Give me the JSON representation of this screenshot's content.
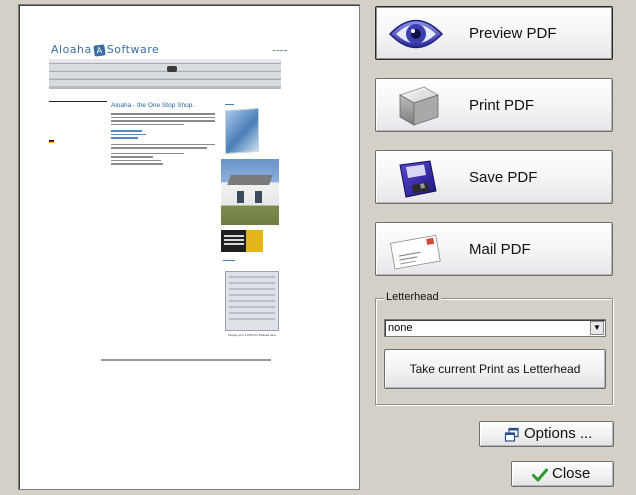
{
  "preview": {
    "logo_text_left": "Aloaha",
    "logo_mark": "A",
    "logo_text_right": "Software",
    "headline": "Aloaha - the One Stop Shop.",
    "screenshot_caption": "Output your 2 PNG for Preload here"
  },
  "buttons": {
    "preview": {
      "label": "Preview PDF",
      "icon": "eye-icon"
    },
    "print": {
      "label": "Print PDF",
      "icon": "printer-box-icon"
    },
    "save": {
      "label": "Save PDF",
      "icon": "floppy-disk-icon"
    },
    "mail": {
      "label": "Mail PDF",
      "icon": "envelope-icon"
    }
  },
  "letterhead": {
    "legend": "Letterhead",
    "selected": "none",
    "take_label": "Take current Print as Letterhead"
  },
  "options": {
    "label": "Options ...",
    "icon": "windows-icon"
  },
  "close": {
    "label": "Close",
    "icon": "checkmark-icon"
  },
  "colors": {
    "background": "#d4d0c8",
    "eye_blue": "#3c3fb0",
    "check_green": "#2e9a2e"
  }
}
